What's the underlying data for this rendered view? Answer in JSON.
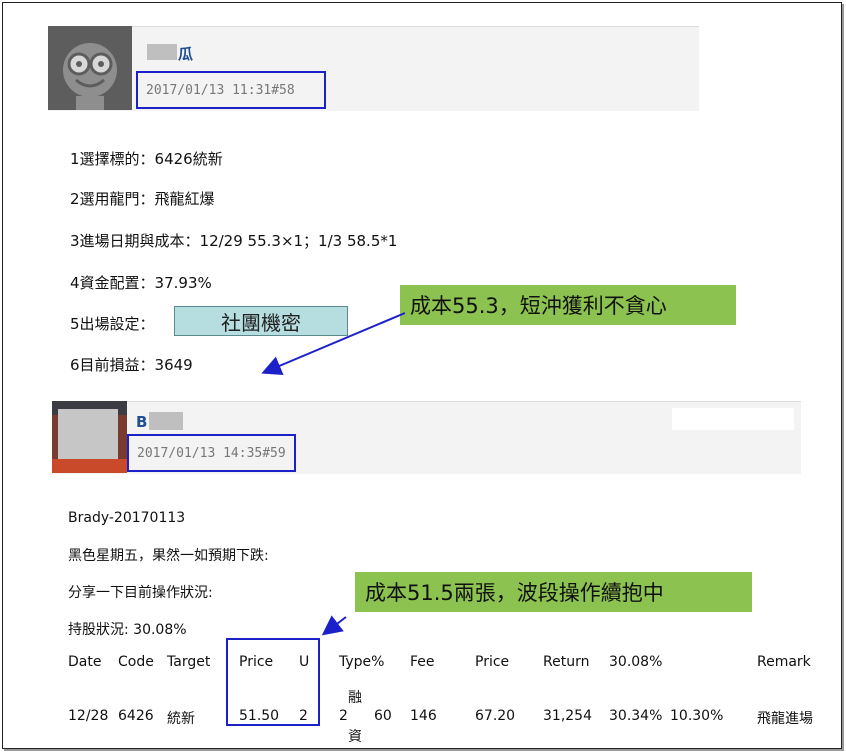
{
  "post1": {
    "username": "瓜",
    "datetime": "2017/01/13 11:31#58",
    "lines": [
      "1選擇標的：6426統新",
      "2選用龍門：飛龍紅爆",
      "3進場日期與成本：12/29 55.3×1；1/3 58.5*1",
      "4資金配置：37.93%",
      "5出場設定：",
      "6目前損益：3649"
    ],
    "secret_label": "社團機密",
    "callout": "成本55.3，短沖獲利不貪心"
  },
  "post2": {
    "username": "B",
    "datetime": "2017/01/13 14:35#59",
    "lines": [
      "Brady-20170113",
      "黑色星期五，果然一如預期下跌:",
      "分享一下目前操作狀況:",
      "持股狀況: 30.08%"
    ],
    "callout": "成本51.5兩張，波段操作續抱中",
    "table": {
      "headers": [
        "Date",
        "Code",
        "Target",
        "Price",
        "U",
        "Type%",
        "Fee",
        "Price",
        "Return",
        "30.08%",
        "Remark"
      ],
      "row": {
        "date": "12/28",
        "code": "6426",
        "target": "統新",
        "price": "51.50",
        "u": "2",
        "type_num": "2",
        "type_top": "融",
        "type_bottom": "資",
        "type_pct": "60",
        "fee": "146",
        "price2": "67.20",
        "return": "31,254",
        "pct1": "30.34%",
        "pct2": "10.30%",
        "remark": "飛龍進場"
      }
    }
  },
  "colors": {
    "highlight_border": "#1b20c8",
    "callout_bg": "#8cc24f",
    "secret_bg": "#b6dde0",
    "username": "#1f4f8f"
  }
}
